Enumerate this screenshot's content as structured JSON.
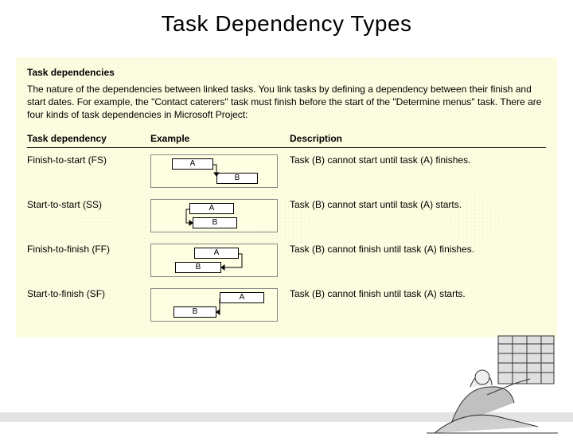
{
  "title": "Task Dependency Types",
  "section_heading": "Task dependencies",
  "intro": "The nature of the dependencies between linked tasks. You link tasks by defining a dependency between their finish and start dates. For example, the \"Contact caterers\" task must finish before the start of the \"Determine menus\" task. There are four kinds of task dependencies in Microsoft Project:",
  "columns": {
    "dependency": "Task dependency",
    "example": "Example",
    "description": "Description"
  },
  "labels": {
    "A": "A",
    "B": "B"
  },
  "rows": [
    {
      "name": "Finish-to-start (FS)",
      "description": "Task (B) cannot start until task (A) finishes."
    },
    {
      "name": "Start-to-start (SS)",
      "description": "Task (B) cannot start until task (A) starts."
    },
    {
      "name": "Finish-to-finish (FF)",
      "description": "Task (B) cannot finish until task (A) finishes."
    },
    {
      "name": "Start-to-finish (SF)",
      "description": "Task (B) cannot finish until task (A) starts."
    }
  ]
}
